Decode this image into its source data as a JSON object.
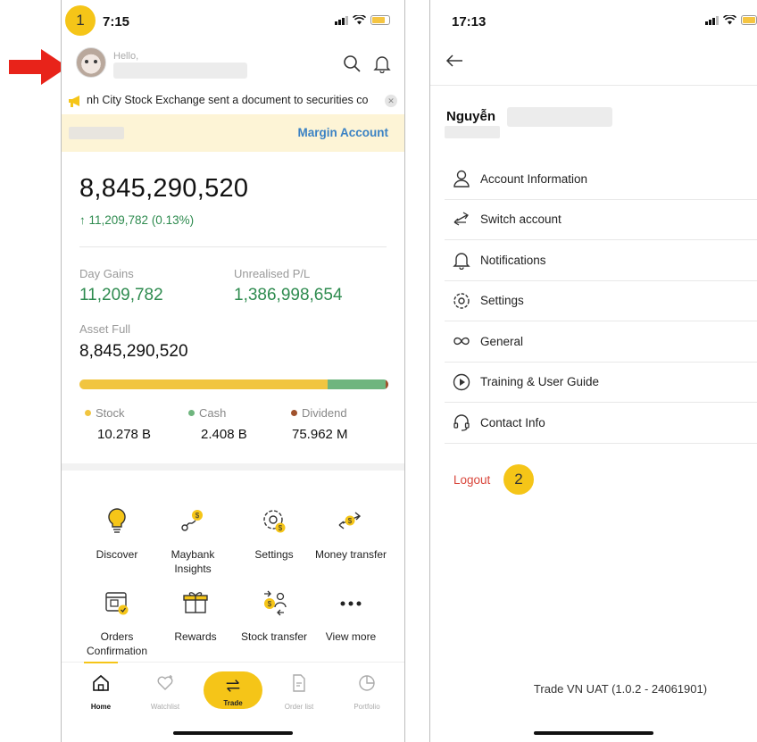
{
  "left_screen": {
    "step_number": "1",
    "status_time": "7:15",
    "greeting": "Hello,",
    "ticker_text": "nh City Stock Exchange sent a document to securities co",
    "margin_link": "Margin Account",
    "total_value": "8,845,290,520",
    "total_change": "↑ 11,209,782 (0.13%)",
    "day_gains_label": "Day Gains",
    "day_gains_value": "11,209,782",
    "unrealised_label": "Unrealised P/L",
    "unrealised_value": "1,386,998,654",
    "asset_full_label": "Asset Full",
    "asset_full_value": "8,845,290,520",
    "allocation": [
      {
        "label": "Stock",
        "value": "10.278 B",
        "fraction": 0.803,
        "color": "#f1c540"
      },
      {
        "label": "Cash",
        "value": "2.408 B",
        "fraction": 0.188,
        "color": "#6fb57e"
      },
      {
        "label": "Dividend",
        "value": "75.962 M",
        "fraction": 0.009,
        "color": "#a0522d"
      }
    ],
    "grid": [
      {
        "label": "Discover",
        "icon": "lightbulb-icon"
      },
      {
        "label": "Maybank Insights",
        "icon": "insights-icon"
      },
      {
        "label": "Settings",
        "icon": "settings-gear-icon"
      },
      {
        "label": "Money transfer",
        "icon": "money-transfer-icon"
      },
      {
        "label": "Orders Confirmation",
        "icon": "calendar-check-icon"
      },
      {
        "label": "Rewards",
        "icon": "gift-icon"
      },
      {
        "label": "Stock transfer",
        "icon": "stock-transfer-icon"
      },
      {
        "label": "View more",
        "icon": "more-dots-icon"
      }
    ],
    "tabs": [
      {
        "label": "Home",
        "icon": "home-icon"
      },
      {
        "label": "Watchlist",
        "icon": "heart-plus-icon"
      },
      {
        "label": "Trade",
        "icon": "swap-icon"
      },
      {
        "label": "Order list",
        "icon": "document-icon"
      },
      {
        "label": "Portfolio",
        "icon": "pie-chart-icon"
      }
    ]
  },
  "right_screen": {
    "status_time": "17:13",
    "user_name": "Nguyễn",
    "menu": [
      {
        "label": "Account Information",
        "icon": "user-icon"
      },
      {
        "label": "Switch account",
        "icon": "switch-arrows-icon"
      },
      {
        "label": "Notifications",
        "icon": "bell-icon"
      },
      {
        "label": "Settings",
        "icon": "gear-icon"
      },
      {
        "label": "General",
        "icon": "infinity-icon"
      },
      {
        "label": "Training & User Guide",
        "icon": "play-circle-icon"
      },
      {
        "label": "Contact Info",
        "icon": "headset-icon"
      }
    ],
    "logout_label": "Logout",
    "step_number": "2",
    "version": "Trade VN UAT (1.0.2 - 24061901)"
  },
  "colors": {
    "accent_yellow": "#f5c518",
    "positive_green": "#2e8b4f",
    "link_blue": "#3b82c4",
    "logout_red": "#d9463b",
    "annotation_red": "#e8231a"
  }
}
